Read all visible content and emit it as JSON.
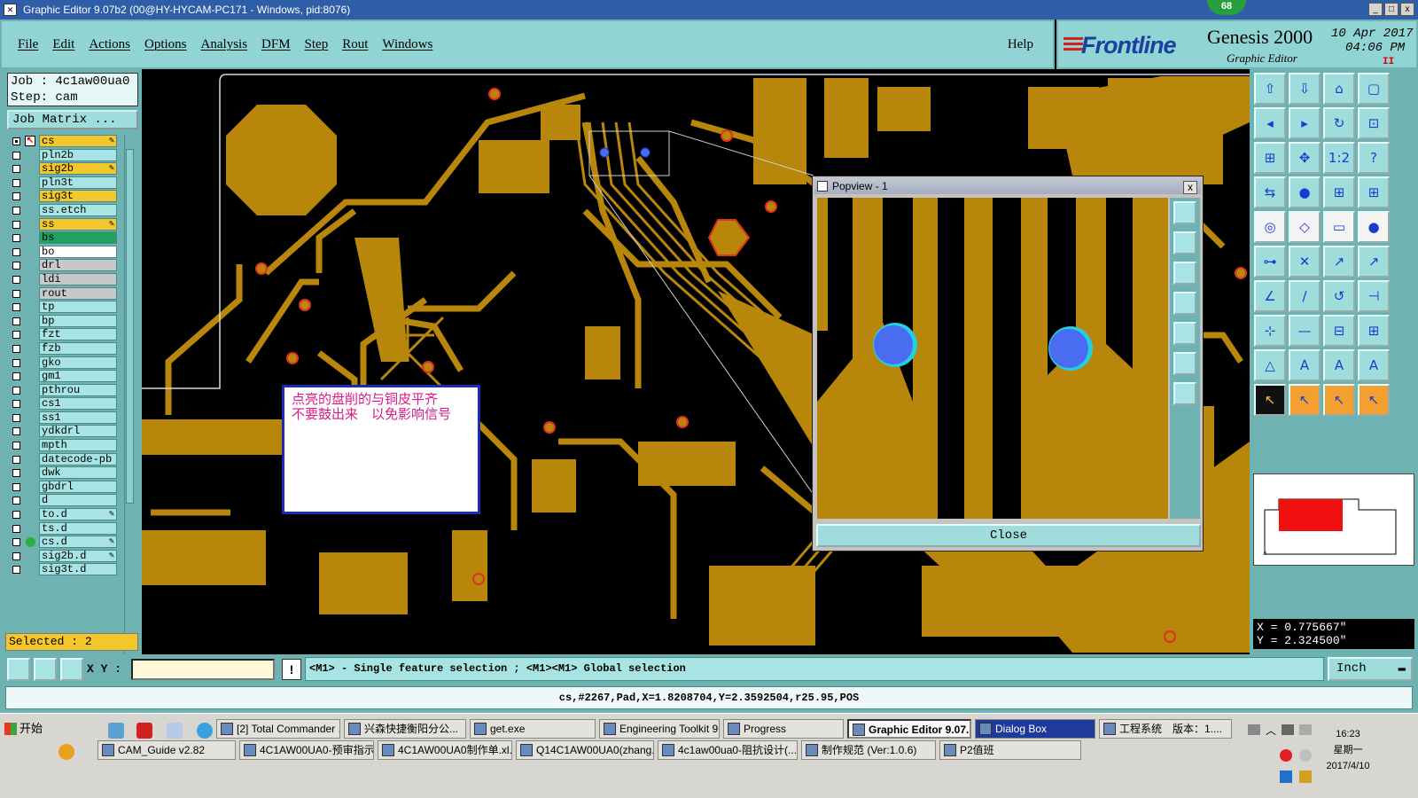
{
  "window": {
    "title": "Graphic Editor 9.07b2 (00@HY-HYCAM-PC171 - Windows, pid:8076)",
    "badge": "68",
    "min": "_",
    "max": "□",
    "close": "x"
  },
  "menu": {
    "items": [
      "File",
      "Edit",
      "Actions",
      "Options",
      "Analysis",
      "DFM",
      "Step",
      "Rout",
      "Windows"
    ],
    "help": "Help"
  },
  "brand": {
    "logo": "Frontline",
    "product": "Genesis 2000",
    "subtitle": "Graphic Editor",
    "date": "10 Apr 2017",
    "time": "04:06 PM",
    "indicator": "II"
  },
  "job": {
    "job_line": "Job : 4c1aw00ua0",
    "step_line": "Step: cam",
    "matrix_button": "Job Matrix ..."
  },
  "layers": [
    {
      "name": "cs",
      "color": "#f4c82c",
      "checked": true,
      "edit": true,
      "special": "cs-active"
    },
    {
      "name": "pln2b",
      "color": "#a8e4e4",
      "checked": false
    },
    {
      "name": "sig2b",
      "color": "#f4c82c",
      "checked": false,
      "edit": true
    },
    {
      "name": "pln3t",
      "color": "#a8e4e4",
      "checked": false
    },
    {
      "name": "sig3t",
      "color": "#f4c82c",
      "checked": false
    },
    {
      "name": "ss.etch",
      "color": "#a8e4e4",
      "checked": false
    },
    {
      "name": "ss",
      "color": "#f4c82c",
      "checked": false,
      "edit": true
    },
    {
      "name": "bs",
      "color": "#22a060",
      "checked": false
    },
    {
      "name": "bo",
      "color": "#ffffff",
      "checked": false
    },
    {
      "name": "drl",
      "color": "#c8c8c8",
      "checked": false
    },
    {
      "name": "ldi",
      "color": "#c8c8c8",
      "checked": false
    },
    {
      "name": "rout",
      "color": "#c8c8c8",
      "checked": false
    },
    {
      "name": "tp",
      "color": "#a8e4e4",
      "checked": false
    },
    {
      "name": "bp",
      "color": "#a8e4e4",
      "checked": false
    },
    {
      "name": "fzt",
      "color": "#a8e4e4",
      "checked": false
    },
    {
      "name": "fzb",
      "color": "#a8e4e4",
      "checked": false
    },
    {
      "name": "gko",
      "color": "#a8e4e4",
      "checked": false
    },
    {
      "name": "gm1",
      "color": "#a8e4e4",
      "checked": false
    },
    {
      "name": "pthrou",
      "color": "#a8e4e4",
      "checked": false
    },
    {
      "name": "cs1",
      "color": "#a8e4e4",
      "checked": false
    },
    {
      "name": "ss1",
      "color": "#a8e4e4",
      "checked": false
    },
    {
      "name": "ydkdrl",
      "color": "#a8e4e4",
      "checked": false
    },
    {
      "name": "mpth",
      "color": "#a8e4e4",
      "checked": false
    },
    {
      "name": "datecode-pb",
      "color": "#a8e4e4",
      "checked": false
    },
    {
      "name": "dwk",
      "color": "#a8e4e4",
      "checked": false
    },
    {
      "name": "gbdrl",
      "color": "#a8e4e4",
      "checked": false
    },
    {
      "name": "d",
      "color": "#a8e4e4",
      "checked": false
    },
    {
      "name": "to.d",
      "color": "#a8e4e4",
      "checked": false,
      "edit": true
    },
    {
      "name": "ts.d",
      "color": "#a8e4e4",
      "checked": false
    },
    {
      "name": "cs.d",
      "color": "#a8e4e4",
      "checked": false,
      "edit": true,
      "dot": true
    },
    {
      "name": "sig2b.d",
      "color": "#a8e4e4",
      "checked": false,
      "edit": true
    },
    {
      "name": "sig3t.d",
      "color": "#a8e4e4",
      "checked": false
    }
  ],
  "selected": "Selected : 2",
  "note": {
    "line1": "点亮的盘削的与铜皮平齐",
    "line2": "不要鼓出来　以免影响信号"
  },
  "popview": {
    "title": "Popview - 1",
    "close_x": "x",
    "close_button": "Close"
  },
  "coords": {
    "x": "X =  0.775667\"",
    "y": "Y =  2.324500\""
  },
  "tool_icons": [
    "zoom-home-icon",
    "zoom-back-icon",
    "home-icon",
    "fit-icon",
    "pan-left-icon",
    "pan-right-icon",
    "redraw-icon",
    "snap-icon",
    "zoom-fit-icon",
    "center-icon",
    "scale-1-2-icon",
    "help-query-icon",
    "measure-icon",
    "pin-icon",
    "layer-red-icon",
    "layer-blue-icon",
    "pad-icon",
    "outline-icon",
    "ruler-icon",
    "circle-pad-icon",
    "connect-icon",
    "cross-icon",
    "line-add-icon",
    "line-end-icon",
    "angle-icon",
    "cut-icon",
    "rotate-icon",
    "flip-icon",
    "nodes-icon",
    "minus-icon",
    "fence-icon",
    "net-icon",
    "triangle-icon",
    "text-a-icon",
    "text-a2-icon",
    "text-a3-icon",
    "pointer-icon",
    "select-icon",
    "move-icon",
    "multi-select-icon"
  ],
  "command": {
    "xy_label": "X Y :",
    "hint": "<M1> - Single feature selection ; <M1><M1> Global selection",
    "unit": "Inch",
    "warn": "!"
  },
  "status": "cs,#2267,Pad,X=1.8208704,Y=2.3592504,r25.95,POS",
  "taskbar": {
    "start": "开始",
    "row1": [
      {
        "label": "[2] Total Commander ...",
        "active": false
      },
      {
        "label": "兴森快捷衡阳分公...",
        "active": false
      },
      {
        "label": "get.exe",
        "active": false
      },
      {
        "label": "Engineering Toolkit 9....",
        "active": false
      },
      {
        "label": "Progress",
        "active": false
      },
      {
        "label": "Graphic Editor 9.07...",
        "active": true
      },
      {
        "label": "Dialog Box",
        "active": false,
        "dlg": true
      },
      {
        "label": "工程系统　版本：1....",
        "active": false
      }
    ],
    "row2": [
      {
        "label": "CAM_Guide v2.82"
      },
      {
        "label": "4C1AW00UA0-预审指示..."
      },
      {
        "label": "4C1AW00UA0制作单.xl..."
      },
      {
        "label": "Q14C1AW00UA0(zhang..."
      },
      {
        "label": "4c1aw00ua0-阻抗设计(..."
      },
      {
        "label": "制作规范 (Ver:1.0.6)"
      },
      {
        "label": "P2值班"
      }
    ],
    "time": "16:23",
    "weekday": "星期一",
    "date": "2017/4/10"
  }
}
